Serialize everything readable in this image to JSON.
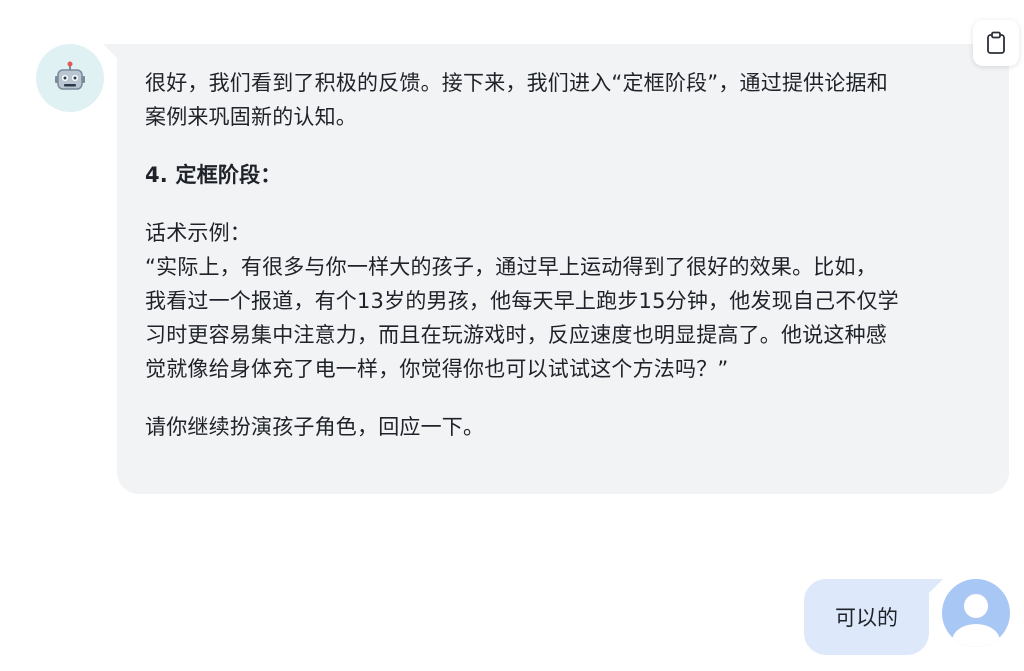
{
  "conversation": {
    "bot_message": {
      "paragraphs": [
        {
          "lines": [
            "很好，我们看到了积极的反馈。接下来，我们进入“定框阶段”，通过提供论据和",
            "案例来巩固新的认知。"
          ]
        },
        {
          "heading": "4. 定框阶段："
        },
        {
          "lines": [
            "话术示例：",
            "“实际上，有很多与你一样大的孩子，通过早上运动得到了很好的效果。比如，",
            "我看过一个报道，有个13岁的男孩，他每天早上跑步15分钟，他发现自己不仅学",
            "习时更容易集中注意力，而且在玩游戏时，反应速度也明显提高了。他说这种感",
            "觉就像给身体充了电一样，你觉得你也可以试试这个方法吗？”"
          ]
        },
        {
          "lines": [
            "请你继续扮演孩子角色，回应一下。"
          ]
        }
      ]
    },
    "user_message": {
      "text": "可以的"
    }
  },
  "icons": {
    "bot_avatar": "robot-icon",
    "copy": "clipboard-icon",
    "user_avatar": "user-icon"
  },
  "colors": {
    "bot_bubble": "#f2f3f5",
    "user_bubble": "#dde9fa",
    "bot_avatar_bg": "#dff1f3",
    "user_avatar_bg": "#a9c7f4"
  }
}
